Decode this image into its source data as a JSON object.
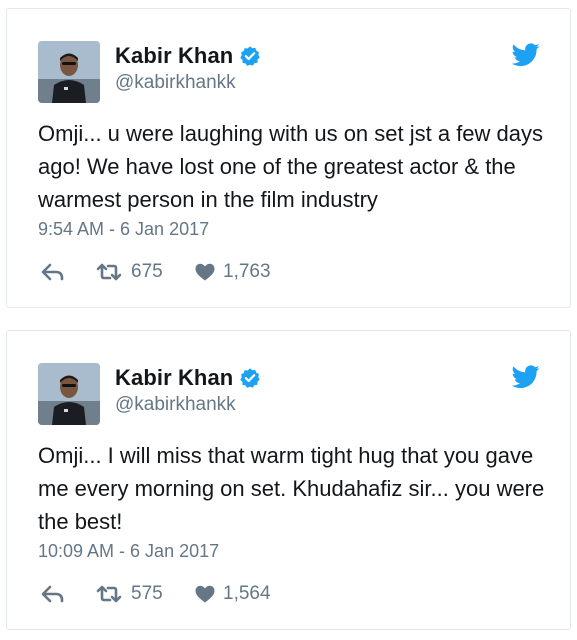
{
  "colors": {
    "text": "#14171a",
    "secondary": "#657786",
    "twitter_blue": "#1da1f2",
    "border": "#e3e8ec"
  },
  "tweets": [
    {
      "author": {
        "display_name": "Kabir Khan",
        "handle": "@kabirkhankk",
        "verified": true,
        "avatar_icon": "avatar-photo"
      },
      "text": "Omji... u were laughing with us on set jst a few days ago! We have lost one of the greatest actor & the warmest person in the film industry",
      "timestamp": "9:54 AM - 6 Jan 2017",
      "retweets": "675",
      "likes": "1,763"
    },
    {
      "author": {
        "display_name": "Kabir Khan",
        "handle": "@kabirkhankk",
        "verified": true,
        "avatar_icon": "avatar-photo"
      },
      "text": "Omji... I will miss that warm tight hug that you gave me every morning on set. Khudahafiz sir... you were the best!",
      "timestamp": "10:09 AM - 6 Jan 2017",
      "retweets": "575",
      "likes": "1,564"
    }
  ]
}
